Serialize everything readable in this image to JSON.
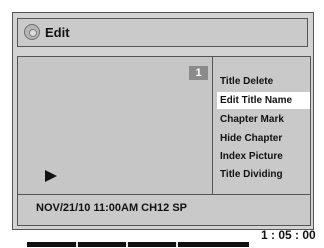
{
  "header": {
    "title": "Edit",
    "icon": "disc-icon"
  },
  "preview": {
    "title_number": "1",
    "play_icon": "play-icon"
  },
  "menu": {
    "items": [
      {
        "label": "Title Delete",
        "selected": false
      },
      {
        "label": "Edit Title Name",
        "selected": true
      },
      {
        "label": "Chapter Mark",
        "selected": false
      },
      {
        "label": "Hide Chapter",
        "selected": false
      },
      {
        "label": "Index Picture",
        "selected": false
      },
      {
        "label": "Title Dividing",
        "selected": false
      }
    ]
  },
  "info": {
    "recording_info": "NOV/21/10 11:00AM CH12 SP"
  },
  "footer": {
    "time": "1 : 05 : 00",
    "progress_marker_fraction": 0.52
  },
  "colors": {
    "screen_bg": "#d3d3d3",
    "selected_bg": "#ffffff",
    "text": "#111111",
    "badge_bg": "#8a8a8a"
  }
}
